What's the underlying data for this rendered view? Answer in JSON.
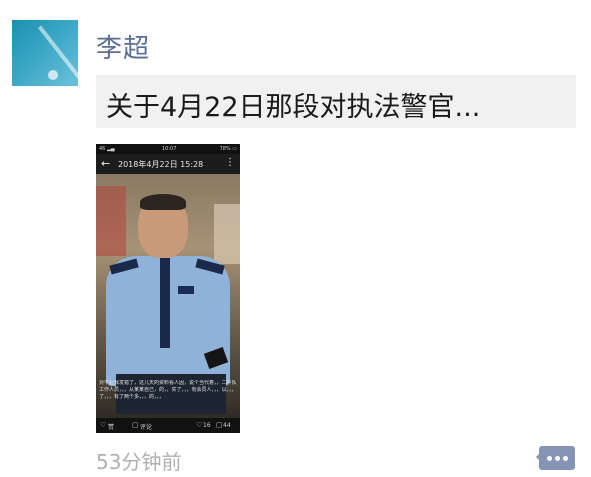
{
  "user": {
    "name": "李超",
    "icon": "avatar-icon"
  },
  "post": {
    "text": "关于4月22日那段对执法警官...",
    "timestamp": "53分钟前"
  },
  "screenshot": {
    "status_left": "46 ▂▄",
    "status_time": "10:07",
    "status_right": "78% ▭",
    "header_date": "2018年4月22日 15:28",
    "caption": "对不起我发错了，这几天的资料看人因，说个当代着，，二中队工作人员，，，从某某自己，的，，实了，，，有会员人，，，以，，，了，，，有了两个多，，，的，，，",
    "footer": {
      "like_label": "赞",
      "comment_label": "评论",
      "likes_count": "16",
      "comments_count": "44"
    }
  },
  "actions": {
    "comment_icon": "comment-bubble-icon"
  },
  "colors": {
    "name": "#5a6d93",
    "post_bg": "#f1f1f1",
    "timestamp": "#b0b0b0",
    "comment_button": "#8594b4"
  }
}
